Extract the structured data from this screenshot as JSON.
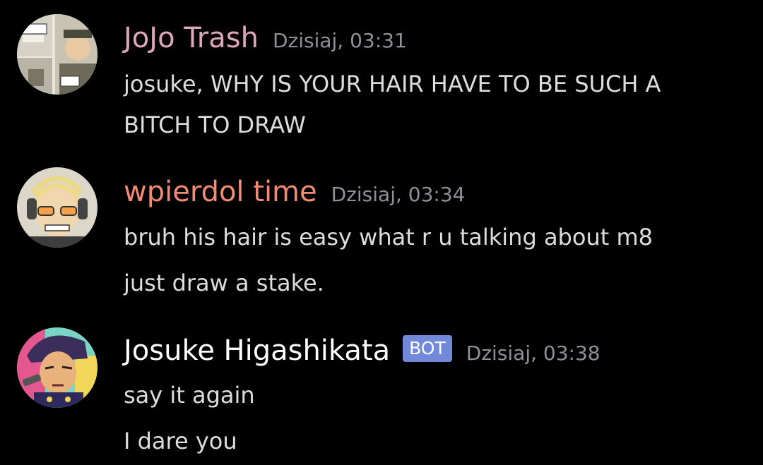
{
  "messages": [
    {
      "username": "JoJo Trash",
      "username_color": "#dca6bb",
      "timestamp": "Dzisiaj, 03:31",
      "avatar_icon": "manga-panel-avatar-icon",
      "lines": [
        "josuke, WHY IS YOUR HAIR HAVE TO BE SUCH A",
        "BITCH TO DRAW"
      ]
    },
    {
      "username": "wpierdol time",
      "username_color": "#f28b73",
      "timestamp": "Dzisiaj, 03:34",
      "avatar_icon": "sunglasses-character-avatar-icon",
      "lines": [
        "bruh his hair is easy what r u talking about m8",
        "just draw a stake."
      ]
    },
    {
      "username": "Josuke Higashikata",
      "username_color": "#ffffff",
      "badge": "BOT",
      "badge_color": "#7289da",
      "timestamp": "Dzisiaj, 03:38",
      "avatar_icon": "josuke-character-avatar-icon",
      "lines": [
        "say it again",
        "I dare you"
      ]
    }
  ]
}
